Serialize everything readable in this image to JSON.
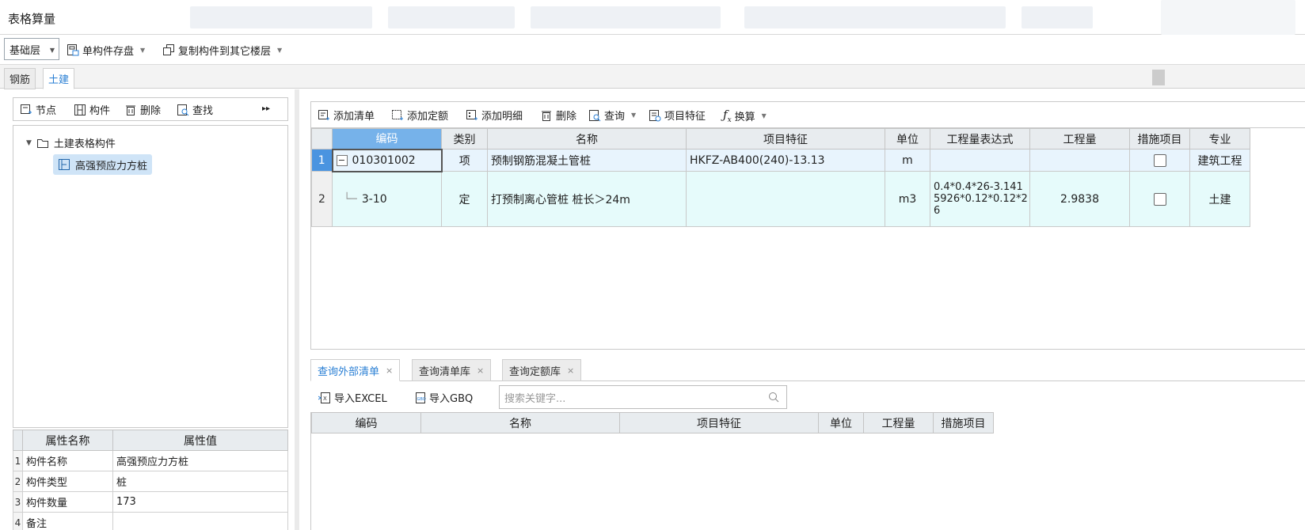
{
  "window": {
    "title": "表格算量"
  },
  "toolbar": {
    "floor_select": "基础层",
    "save_component": "单构件存盘",
    "copy_component": "复制构件到其它楼层"
  },
  "tabs": [
    {
      "label": "钢筋"
    },
    {
      "label": "土建"
    }
  ],
  "left_toolbar": {
    "node": "节点",
    "component": "构件",
    "delete": "删除",
    "find": "查找",
    "more": "▸▸"
  },
  "tree": {
    "root": "土建表格构件",
    "child": "高强预应力方桩"
  },
  "properties": {
    "headers": [
      "属性名称",
      "属性值"
    ],
    "rows": [
      {
        "idx": "1",
        "name": "构件名称",
        "value": "高强预应力方桩"
      },
      {
        "idx": "2",
        "name": "构件类型",
        "value": "桩"
      },
      {
        "idx": "3",
        "name": "构件数量",
        "value": "173"
      },
      {
        "idx": "4",
        "name": "备注",
        "value": ""
      }
    ]
  },
  "right_toolbar": {
    "add_list": "添加清单",
    "add_quota": "添加定额",
    "add_detail": "添加明细",
    "delete": "删除",
    "query": "查询",
    "item_feature": "项目特征",
    "convert": "换算"
  },
  "main_grid": {
    "headers": [
      "编码",
      "类别",
      "名称",
      "项目特征",
      "单位",
      "工程量表达式",
      "工程量",
      "措施项目",
      "专业"
    ],
    "rows": [
      {
        "num": "1",
        "code": "010301002",
        "category": "项",
        "name": "预制钢筋混凝土管桩",
        "feature": "HKFZ-AB400(240)-13.13",
        "unit": "m",
        "expression": "",
        "quantity": "",
        "measure": false,
        "profession": "建筑工程"
      },
      {
        "num": "2",
        "code": "3-10",
        "category": "定",
        "name": "打预制离心管桩 桩长＞24m",
        "feature": "",
        "unit": "m3",
        "expression": "0.4*0.4*26-3.1415926*0.12*0.12*26",
        "quantity": "2.9838",
        "measure": false,
        "profession": "土建"
      }
    ]
  },
  "bottom_tabs": [
    {
      "label": "查询外部清单"
    },
    {
      "label": "查询清单库"
    },
    {
      "label": "查询定额库"
    }
  ],
  "bottom_toolbar": {
    "import_excel": "导入EXCEL",
    "import_gbq": "导入GBQ",
    "search_placeholder": "搜索关键字..."
  },
  "sub_grid": {
    "headers": [
      "编码",
      "名称",
      "项目特征",
      "单位",
      "工程量",
      "措施项目"
    ]
  },
  "colors": {
    "accent": "#2a7fd4",
    "selected_header": "#76b2ea",
    "row1_bg": "#e8f4fd",
    "row2_bg": "#e6fbfb"
  }
}
